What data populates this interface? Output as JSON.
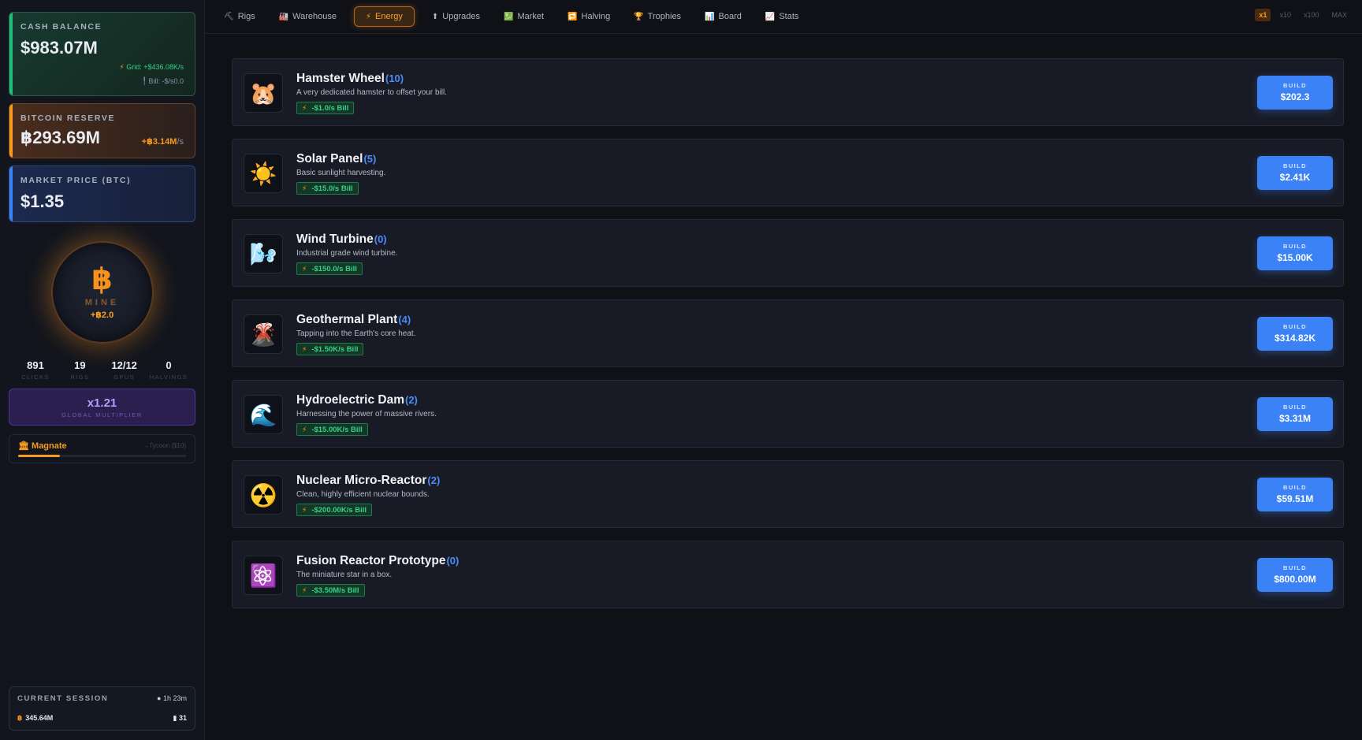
{
  "sidebar": {
    "cash": {
      "label": "CASH BALANCE",
      "value": "$983.07M",
      "grid": "Grid: +$436.08K/s",
      "bill": "Bill: -$/s0.0"
    },
    "btc": {
      "label": "BITCOIN RESERVE",
      "value": "฿293.69M",
      "rate": "+฿3.14M",
      "per": "/s"
    },
    "price": {
      "label": "MARKET PRICE (BTC)",
      "value": "$1.35"
    },
    "mine": {
      "glyph": "฿",
      "label": "MINE",
      "gain": "+฿2.0"
    },
    "counters": [
      {
        "value": "891",
        "label": "CLICKS"
      },
      {
        "value": "19",
        "label": "RIGS"
      },
      {
        "value": "12/12",
        "label": "GPUS"
      },
      {
        "value": "0",
        "label": "HALVINGS"
      }
    ],
    "multiplier": {
      "value": "x1.21",
      "label": "GLOBAL MULTIPLIER"
    },
    "rank": {
      "name": "Magnate",
      "next": "→Tycoon ($10)",
      "progress": 0.25
    },
    "session": {
      "label": "CURRENT SESSION",
      "time": "1h 23m",
      "btc": "345.64M",
      "count": "31"
    }
  },
  "tabs": [
    {
      "icon": "⛏",
      "label": "Rigs"
    },
    {
      "icon": "🏭",
      "label": "Warehouse"
    },
    {
      "icon": "⚡",
      "label": "Energy",
      "active": true
    },
    {
      "icon": "⬆",
      "label": "Upgrades"
    },
    {
      "icon": "💹",
      "label": "Market"
    },
    {
      "icon": "🔁",
      "label": "Halving"
    },
    {
      "icon": "🏆",
      "label": "Trophies"
    },
    {
      "icon": "📊",
      "label": "Board"
    },
    {
      "icon": "📈",
      "label": "Stats"
    }
  ],
  "buy_multipliers": [
    "x1",
    "x10",
    "x100",
    "MAX"
  ],
  "energy": [
    {
      "icon": "🐹",
      "name": "Hamster Wheel",
      "count": "(10)",
      "desc": "A very dedicated hamster to offset your bill.",
      "bill": "-$1.0/s Bill",
      "build_label": "BUILD",
      "price": "$202.3"
    },
    {
      "icon": "☀️",
      "name": "Solar Panel",
      "count": "(5)",
      "desc": "Basic sunlight harvesting.",
      "bill": "-$15.0/s Bill",
      "build_label": "BUILD",
      "price": "$2.41K"
    },
    {
      "icon": "🌬️",
      "name": "Wind Turbine",
      "count": "(0)",
      "desc": "Industrial grade wind turbine.",
      "bill": "-$150.0/s Bill",
      "build_label": "BUILD",
      "price": "$15.00K"
    },
    {
      "icon": "🌋",
      "name": "Geothermal Plant",
      "count": "(4)",
      "desc": "Tapping into the Earth's core heat.",
      "bill": "-$1.50K/s Bill",
      "build_label": "BUILD",
      "price": "$314.82K"
    },
    {
      "icon": "🌊",
      "name": "Hydroelectric Dam",
      "count": "(2)",
      "desc": "Harnessing the power of massive rivers.",
      "bill": "-$15.00K/s Bill",
      "build_label": "BUILD",
      "price": "$3.31M"
    },
    {
      "icon": "☢️",
      "name": "Nuclear Micro-Reactor",
      "count": "(2)",
      "desc": "Clean, highly efficient nuclear bounds.",
      "bill": "-$200.00K/s Bill",
      "build_label": "BUILD",
      "price": "$59.51M"
    },
    {
      "icon": "⚛️",
      "name": "Fusion Reactor Prototype",
      "count": "(0)",
      "desc": "The miniature star in a box.",
      "bill": "-$3.50M/s Bill",
      "build_label": "BUILD",
      "price": "$800.00M"
    }
  ]
}
